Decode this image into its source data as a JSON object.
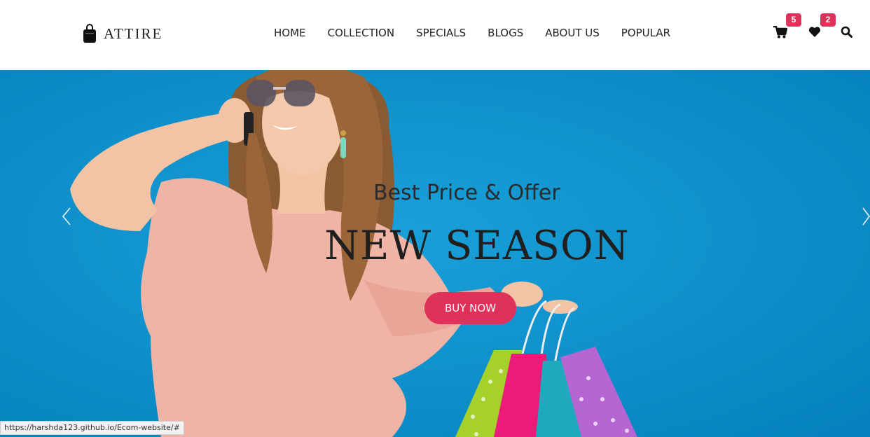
{
  "brand": {
    "name": "ATTIRE",
    "logo_icon": "shopping-bag-icon"
  },
  "nav": {
    "items": [
      {
        "label": "HOME"
      },
      {
        "label": "COLLECTION"
      },
      {
        "label": "SPECIALS"
      },
      {
        "label": "BLOGS"
      },
      {
        "label": "ABOUT US"
      },
      {
        "label": "POPULAR"
      }
    ]
  },
  "header_icons": {
    "cart": {
      "icon": "cart-icon",
      "count": "5"
    },
    "wishlist": {
      "icon": "heart-icon",
      "count": "2"
    },
    "search": {
      "icon": "search-icon"
    }
  },
  "hero": {
    "tagline": "Best Price & Offer",
    "headline": "NEW SEASON",
    "button_label": "BUY NOW",
    "background_color": "#0a8fcc"
  },
  "colors": {
    "accent": "#e0315a",
    "text": "#222222",
    "hero_bg": "#0a8fcc"
  },
  "status_bar": {
    "url": "https://harshda123.github.io/Ecom-website/#"
  }
}
